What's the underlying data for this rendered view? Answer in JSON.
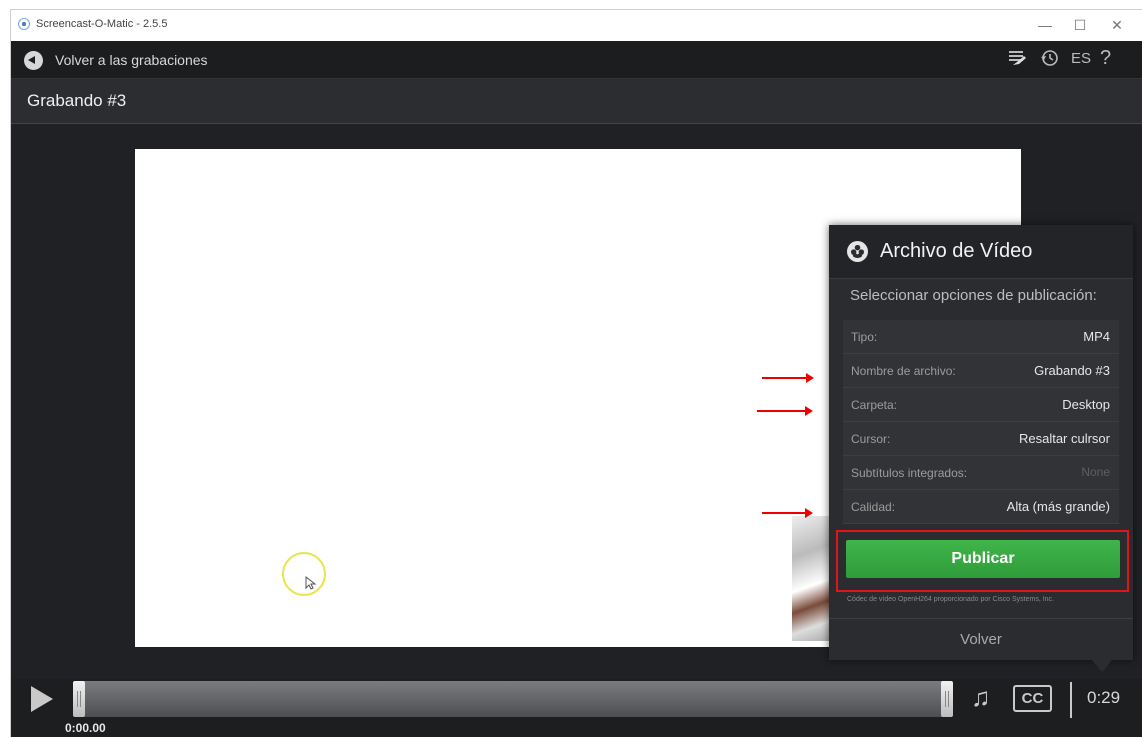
{
  "window": {
    "title": "Screencast-O-Matic - 2.5.5",
    "minimize": "—",
    "maximize": "☐",
    "close": "✕"
  },
  "nav": {
    "back_label": "Volver a las grabaciones",
    "language": "ES",
    "help": "?",
    "icons": [
      "edit-list-icon",
      "history-icon"
    ]
  },
  "recording_title": "Grabando #3",
  "panel": {
    "title": "Archivo de Vídeo",
    "subtitle": "Seleccionar opciones de publicación:",
    "options": [
      {
        "label": "Tipo:",
        "value": "MP4"
      },
      {
        "label": "Nombre de archivo:",
        "value": "Grabando #3"
      },
      {
        "label": "Carpeta:",
        "value": "Desktop"
      },
      {
        "label": "Cursor:",
        "value": "Resaltar culrsor"
      },
      {
        "label": "Subtítulos integrados:",
        "value": "None"
      },
      {
        "label": "Calidad:",
        "value": "Alta (más grande)"
      }
    ],
    "publish": "Publicar",
    "codec_note": "Códec de vídeo OpenH264 proporcionado por Cisco Systems, Inc.",
    "back": "Volver"
  },
  "player": {
    "start_time": "0:00.00",
    "duration": "0:29",
    "cc_label": "CC",
    "progress": 0
  },
  "colors": {
    "publish_green": "#34a43f",
    "highlight_red": "#e0141a",
    "cursor_ring": "#e8e44a"
  }
}
